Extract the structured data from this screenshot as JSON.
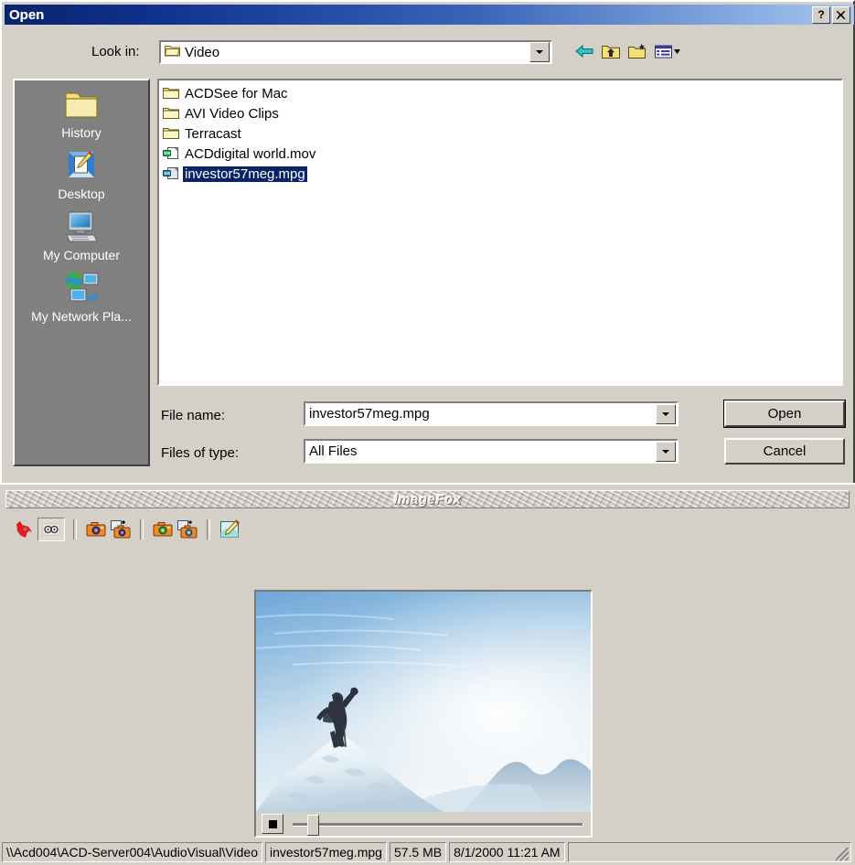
{
  "dialog": {
    "title": "Open",
    "help_button": "?",
    "close_button": "✕",
    "lookin_label": "Look in:",
    "lookin_value": "Video",
    "nav_icons": [
      "back-arrow-icon",
      "up-one-level-icon",
      "new-folder-icon",
      "views-dropdown-icon"
    ],
    "places": [
      {
        "label": "History",
        "icon": "history-folder-icon"
      },
      {
        "label": "Desktop",
        "icon": "desktop-icon"
      },
      {
        "label": "My Computer",
        "icon": "my-computer-icon"
      },
      {
        "label": "My Network Pla...",
        "icon": "my-network-places-icon"
      }
    ],
    "files": [
      {
        "name": "ACDSee for Mac",
        "type": "folder",
        "selected": false
      },
      {
        "name": "AVI Video Clips",
        "type": "folder",
        "selected": false
      },
      {
        "name": "Terracast",
        "type": "folder",
        "selected": false
      },
      {
        "name": "ACDdigital world.mov",
        "type": "video-green",
        "selected": false
      },
      {
        "name": "investor57meg.mpg",
        "type": "video-blue",
        "selected": true
      }
    ],
    "filename_label": "File name:",
    "filename_value": "investor57meg.mpg",
    "filetype_label": "Files of type:",
    "filetype_value": "All Files",
    "open_button": "Open",
    "cancel_button": "Cancel"
  },
  "imagefox": {
    "title": "ImageFox",
    "toolbar": [
      {
        "name": "fox-logo-icon",
        "pressed": false
      },
      {
        "name": "binoculars-toggle-icon",
        "pressed": true
      },
      {
        "name": "acquire-camera-icon",
        "pressed": false
      },
      {
        "name": "add-camera-image-icon",
        "pressed": false
      },
      {
        "name": "acquire-camera-green-icon",
        "pressed": false
      },
      {
        "name": "add-camera-image-green-icon",
        "pressed": false
      },
      {
        "name": "edit-image-icon",
        "pressed": false
      }
    ],
    "preview": {
      "alt": "mountaineer silhouette on snowy summit with blue sky",
      "stop_button": "stop-icon",
      "seek_position_percent": 4
    },
    "status": {
      "path": "\\\\Acd004\\ACD-Server004\\AudioVisual\\Video",
      "filename": "investor57meg.mpg",
      "filesize": "57.5 MB",
      "datetime": "8/1/2000 11:21 AM"
    }
  },
  "colors": {
    "titlebar_dark": "#0a246a",
    "titlebar_light": "#a6c8ee",
    "face": "#d4d0c8",
    "selection": "#0a246a",
    "places_bg": "#808080"
  }
}
